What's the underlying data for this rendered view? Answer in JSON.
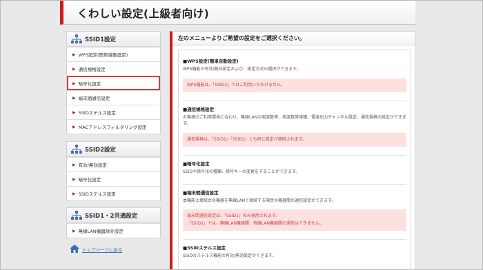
{
  "header": {
    "title": "くわしい設定(上級者向け)"
  },
  "sidebar": {
    "ssid1": {
      "title": "SSID1設定",
      "items": [
        {
          "label": "WPS設定(簡単自動設定)"
        },
        {
          "label": "通信規格設定"
        },
        {
          "label": "暗号化設定"
        },
        {
          "label": "端末間通信設定"
        },
        {
          "label": "SSIDステルス設定"
        },
        {
          "label": "MACアドレスフィルタリング設定"
        }
      ]
    },
    "ssid2": {
      "title": "SSID2設定",
      "items": [
        {
          "label": "有効/無効設定"
        },
        {
          "label": "暗号化設定"
        },
        {
          "label": "SSIDステルス設定"
        }
      ]
    },
    "common": {
      "title": "SSID1・2共通設定",
      "items": [
        {
          "label": "無線LAN機器除外設定"
        }
      ]
    },
    "home_link": "トップページに戻る"
  },
  "main": {
    "title": "左のメニューよりご希望の設定をご選択ください。",
    "sections": [
      {
        "title": "■WPS設定(簡単自動設定)",
        "desc": "WPS機能の有効/無効設定および、設定方式の選択ができます。",
        "note1": "WPS機能は、「SSID2」ではご利用いただけません。"
      },
      {
        "title": "■通信規格設定",
        "desc": "お客様のご利用環境に合わせ、無線LANの周波数帯、周波数帯域幅、電波出力チャンネル設定、通信規格の設定ができます。",
        "note1": "通信規格は、「SSID1」「SSID2」とも同じ設定が適用されます。"
      },
      {
        "title": "■暗号化設定",
        "desc": "SSIDや暗号化の種類、暗号キーの変更をすることができます。"
      },
      {
        "title": "■端末間通信設定",
        "desc": "本機能と接続台の機器を無線LANで接続する場合の機器間の通信設定ができます。",
        "note1": "端末間通信設定は、「SSID1」のみ適用されます。",
        "note2": "「SSID2」では、無線LAN機器間、有線LAN機器間の通信はできません。"
      },
      {
        "title": "■SSIDステルス設定",
        "desc": "SSIDのステルス機能の有効/無効設定ができます。"
      }
    ]
  },
  "colors": {
    "accent": "#cc1c1c",
    "note_bg": "#fde0e0",
    "link": "#3a6fb4"
  },
  "icons": {
    "network": "network-icon",
    "arrow": "arrow-right-icon",
    "home": "home-icon"
  }
}
